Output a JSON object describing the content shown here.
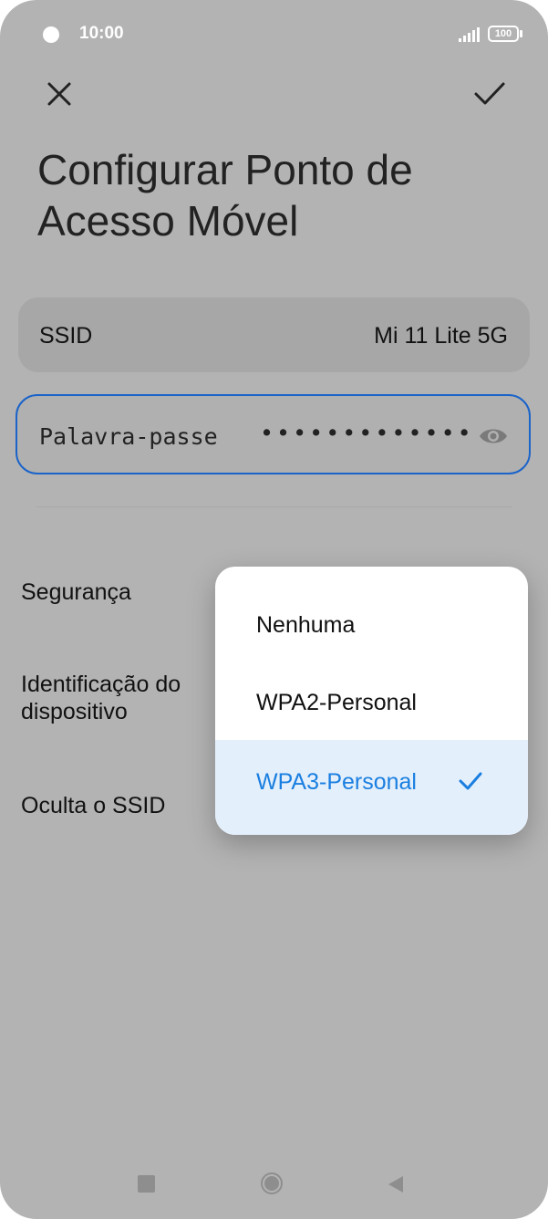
{
  "status_bar": {
    "time": "10:00",
    "battery": "100"
  },
  "header": {
    "title": "Configurar Ponto de Acesso Móvel"
  },
  "ssid": {
    "label": "SSID",
    "value": "Mi 11 Lite 5G"
  },
  "password": {
    "label": "Palavra-passe",
    "value": "•••••••••••••"
  },
  "settings": {
    "security_label": "Segurança",
    "device_id_label": "Identificação do dispositivo",
    "hide_ssid_label": "Oculta o SSID"
  },
  "dropdown": {
    "options": [
      {
        "label": "Nenhuma"
      },
      {
        "label": "WPA2-Personal"
      },
      {
        "label": "WPA3-Personal"
      }
    ],
    "selected_index": 2
  },
  "colors": {
    "accent": "#1a7fe0",
    "selected_bg": "#e4effc",
    "overlay": "#b3b3b3"
  },
  "icons": [
    "close-icon",
    "check-icon",
    "eye-icon",
    "recent-apps-icon",
    "home-icon",
    "back-icon"
  ]
}
